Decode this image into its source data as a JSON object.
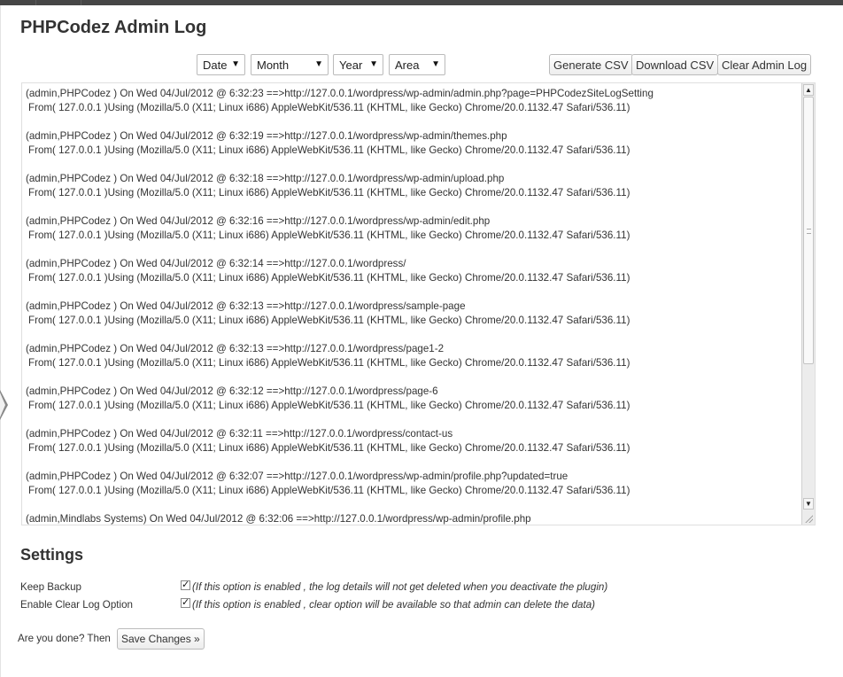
{
  "page": {
    "title": "PHPCodez Admin Log"
  },
  "filters": {
    "date": "Date",
    "month": "Month",
    "year": "Year",
    "area": "Area",
    "arrow": "▼"
  },
  "actions": {
    "generate_csv": "Generate CSV",
    "download_csv": "Download CSV",
    "clear_log": "Clear Admin Log"
  },
  "log": {
    "entries": [
      {
        "line1": "(admin,PHPCodez ) On Wed 04/Jul/2012 @ 6:32:23 ==>http://127.0.0.1/wordpress/wp-admin/admin.php?page=PHPCodezSiteLogSetting",
        "line2": "From( 127.0.0.1 )Using (Mozilla/5.0 (X11; Linux i686) AppleWebKit/536.11 (KHTML, like Gecko) Chrome/20.0.1132.47 Safari/536.11)"
      },
      {
        "line1": "(admin,PHPCodez ) On Wed 04/Jul/2012 @ 6:32:19 ==>http://127.0.0.1/wordpress/wp-admin/themes.php",
        "line2": "From( 127.0.0.1 )Using (Mozilla/5.0 (X11; Linux i686) AppleWebKit/536.11 (KHTML, like Gecko) Chrome/20.0.1132.47 Safari/536.11)"
      },
      {
        "line1": "(admin,PHPCodez ) On Wed 04/Jul/2012 @ 6:32:18 ==>http://127.0.0.1/wordpress/wp-admin/upload.php",
        "line2": "From( 127.0.0.1 )Using (Mozilla/5.0 (X11; Linux i686) AppleWebKit/536.11 (KHTML, like Gecko) Chrome/20.0.1132.47 Safari/536.11)"
      },
      {
        "line1": "(admin,PHPCodez ) On Wed 04/Jul/2012 @ 6:32:16 ==>http://127.0.0.1/wordpress/wp-admin/edit.php",
        "line2": "From( 127.0.0.1 )Using (Mozilla/5.0 (X11; Linux i686) AppleWebKit/536.11 (KHTML, like Gecko) Chrome/20.0.1132.47 Safari/536.11)"
      },
      {
        "line1": "(admin,PHPCodez ) On Wed 04/Jul/2012 @ 6:32:14 ==>http://127.0.0.1/wordpress/",
        "line2": "From( 127.0.0.1 )Using (Mozilla/5.0 (X11; Linux i686) AppleWebKit/536.11 (KHTML, like Gecko) Chrome/20.0.1132.47 Safari/536.11)"
      },
      {
        "line1": "(admin,PHPCodez ) On Wed 04/Jul/2012 @ 6:32:13 ==>http://127.0.0.1/wordpress/sample-page",
        "line2": "From( 127.0.0.1 )Using (Mozilla/5.0 (X11; Linux i686) AppleWebKit/536.11 (KHTML, like Gecko) Chrome/20.0.1132.47 Safari/536.11)"
      },
      {
        "line1": "(admin,PHPCodez ) On Wed 04/Jul/2012 @ 6:32:13 ==>http://127.0.0.1/wordpress/page1-2",
        "line2": "From( 127.0.0.1 )Using (Mozilla/5.0 (X11; Linux i686) AppleWebKit/536.11 (KHTML, like Gecko) Chrome/20.0.1132.47 Safari/536.11)"
      },
      {
        "line1": "(admin,PHPCodez ) On Wed 04/Jul/2012 @ 6:32:12 ==>http://127.0.0.1/wordpress/page-6",
        "line2": "From( 127.0.0.1 )Using (Mozilla/5.0 (X11; Linux i686) AppleWebKit/536.11 (KHTML, like Gecko) Chrome/20.0.1132.47 Safari/536.11)"
      },
      {
        "line1": "(admin,PHPCodez ) On Wed 04/Jul/2012 @ 6:32:11 ==>http://127.0.0.1/wordpress/contact-us",
        "line2": "From( 127.0.0.1 )Using (Mozilla/5.0 (X11; Linux i686) AppleWebKit/536.11 (KHTML, like Gecko) Chrome/20.0.1132.47 Safari/536.11)"
      },
      {
        "line1": "(admin,PHPCodez ) On Wed 04/Jul/2012 @ 6:32:07 ==>http://127.0.0.1/wordpress/wp-admin/profile.php?updated=true",
        "line2": "From( 127.0.0.1 )Using (Mozilla/5.0 (X11; Linux i686) AppleWebKit/536.11 (KHTML, like Gecko) Chrome/20.0.1132.47 Safari/536.11)"
      },
      {
        "line1": "(admin,Mindlabs Systems) On Wed 04/Jul/2012 @ 6:32:06 ==>http://127.0.0.1/wordpress/wp-admin/profile.php",
        "line2": ""
      }
    ]
  },
  "settings": {
    "title": "Settings",
    "keep_backup": {
      "label": "Keep Backup",
      "checked": true,
      "note": "(If this option is enabled , the log details will not get deleted when you deactivate the plugin)"
    },
    "enable_clear": {
      "label": "Enable Clear Log Option",
      "checked": true,
      "note": "(If this option is enabled , clear option will be available so that admin can delete the data)"
    }
  },
  "footer": {
    "prompt": "Are you done? Then",
    "save_label": "Save Changes »"
  },
  "icons": {
    "checkmark": "✓",
    "scroll_up": "▲",
    "scroll_down": "▼"
  },
  "colors": {
    "topbar": "#464646",
    "text": "#333333",
    "border": "#dfdfdf"
  }
}
